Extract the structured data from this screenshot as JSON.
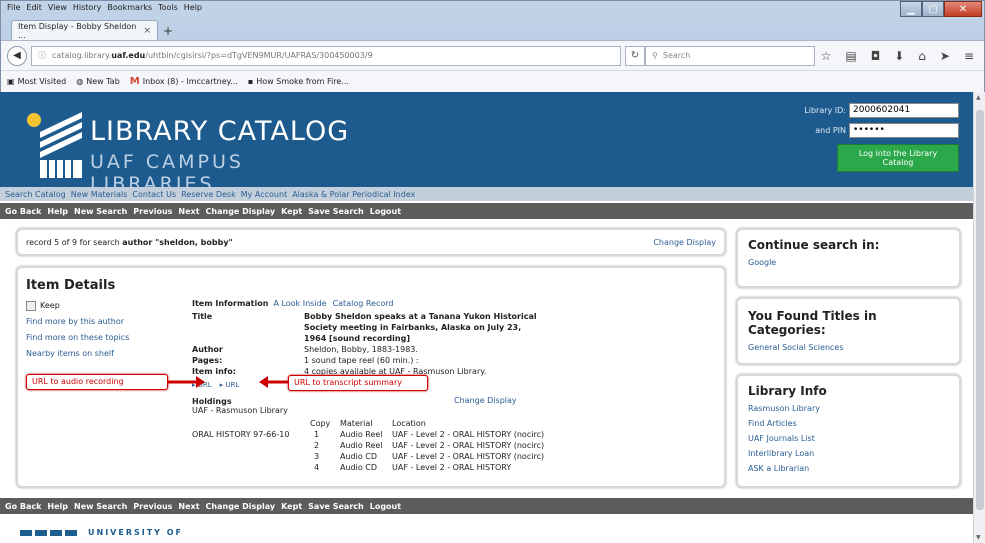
{
  "window": {
    "menu": [
      "File",
      "Edit",
      "View",
      "History",
      "Bookmarks",
      "Tools",
      "Help"
    ],
    "tab_title": "Item Display - Bobby Sheldon ...",
    "url_prefix": "catalog.library.",
    "url_domain": "uaf.edu",
    "url_rest": "/uhtbin/cgisirsi/?ps=dTgVEN9MUR/UAFRAS/300450003/9",
    "search_placeholder": "Search",
    "bookmarks": [
      "Most Visited",
      "New Tab",
      "Inbox (8) - lmccartney...",
      "How Smoke from Fire..."
    ]
  },
  "banner": {
    "title1": "LIBRARY CATALOG",
    "title2": "UAF CAMPUS LIBRARIES",
    "library_id_label": "Library ID:",
    "library_id_value": "2000602041",
    "pin_label": "and PIN",
    "pin_value": "••••••",
    "login_button": "Log into the Library Catalog"
  },
  "subnav": [
    "Search Catalog",
    "New Materials",
    "Contact Us",
    "Reserve Desk",
    "My Account",
    "Alaska & Polar Periodical Index"
  ],
  "toolbar": [
    "Go Back",
    "Help",
    "New Search",
    "Previous",
    "Next",
    "Change Display",
    "Kept",
    "Save Search",
    "Logout"
  ],
  "record": {
    "text_prefix": "record 5 of 9 for search ",
    "text_bold": "author \"sheldon, bobby\"",
    "change_display": "Change Display"
  },
  "item": {
    "heading": "Item Details",
    "keep": "Keep",
    "left_links": [
      "Find more by this author",
      "Find more on these topics",
      "Nearby items on shelf"
    ],
    "info_label": "Item Information",
    "info_links": [
      "A Look Inside",
      "Catalog Record"
    ],
    "title_label": "Title",
    "title_lines": [
      "Bobby Sheldon speaks at a Tanana Yukon Historical",
      "Society meeting in Fairbanks, Alaska on July 23,",
      "1964 [sound recording]"
    ],
    "author_label": "Author",
    "author_value": "Sheldon, Bobby, 1883-1983.",
    "pages_label": "Pages:",
    "pages_value": "1 sound tape reel (60 min.) :",
    "iteminfo_label": "Item info:",
    "iteminfo_value": "4 copies available at UAF - Rasmuson Library.",
    "url1": "▸ URL",
    "url2": "▸ URL",
    "holdings_label": "Holdings",
    "holdings_change": "Change Display",
    "holdings_library": "UAF - Rasmuson Library",
    "call_number": "ORAL HISTORY 97-66-10",
    "copy_headers": [
      "Copy",
      "Material",
      "Location"
    ],
    "copies": [
      {
        "copy": "1",
        "material": "Audio Reel",
        "location": "UAF - Level 2 - ORAL HISTORY (nocirc)"
      },
      {
        "copy": "2",
        "material": "Audio Reel",
        "location": "UAF - Level 2 - ORAL HISTORY (nocirc)"
      },
      {
        "copy": "3",
        "material": "Audio CD",
        "location": "UAF - Level 2 - ORAL HISTORY (nocirc)"
      },
      {
        "copy": "4",
        "material": "Audio CD",
        "location": "UAF - Level 2 - ORAL HISTORY"
      }
    ]
  },
  "annotations": {
    "audio": "URL to audio recording",
    "transcript": "URL to transcript summary"
  },
  "side": {
    "continue_heading": "Continue search in:",
    "continue_links": [
      "Google"
    ],
    "found_heading": "You Found Titles in Categories:",
    "found_links": [
      "General Social Sciences"
    ],
    "info_heading": "Library Info",
    "info_links": [
      "Rasmuson Library",
      "Find Articles",
      "UAF Journals List",
      "Interlibrary Loan",
      "ASK a Librarian"
    ]
  },
  "footer": {
    "university": "UNIVERSITY OF"
  },
  "colors": {
    "banner": "#1d5b8f",
    "toolbar": "#5c5c5c",
    "login_button": "#2ba84a",
    "annotation": "#cc0000"
  }
}
